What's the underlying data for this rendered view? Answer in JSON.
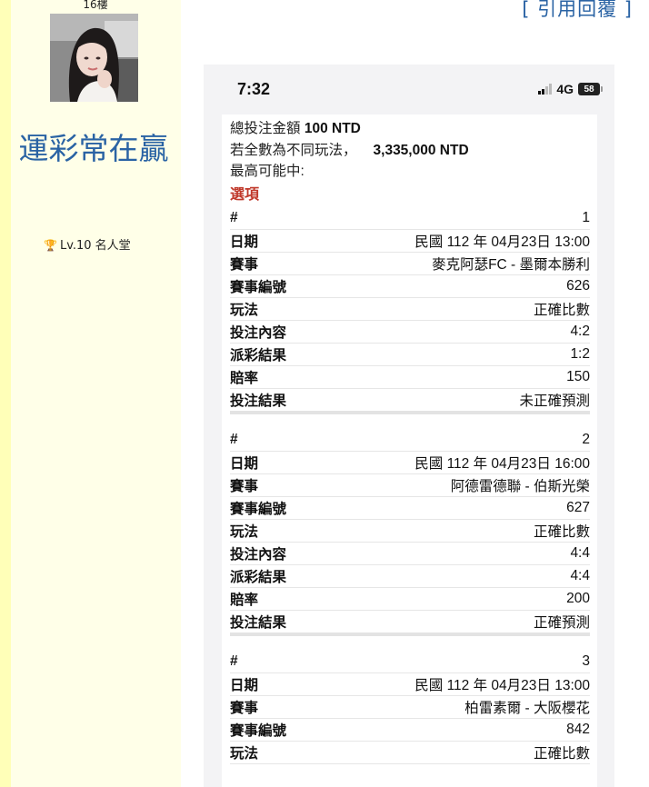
{
  "post": {
    "floor": "16樓",
    "quote_reply": "[ 引用回覆 ]"
  },
  "user": {
    "name": "運彩常在贏",
    "level": "Lv.10 名人堂",
    "level_icon": "trophy-icon"
  },
  "phone": {
    "time": "7:32",
    "network": "4G",
    "battery": "58"
  },
  "summary": {
    "total_label": "總投注金額",
    "total_value": "100 NTD",
    "alt_label": "若全數為不同玩法，",
    "alt_value": "3,335,000 NTD",
    "max_label": "最高可能中:"
  },
  "options_title": "選項",
  "labels": {
    "no": "#",
    "date": "日期",
    "match": "賽事",
    "match_id": "賽事編號",
    "play": "玩法",
    "content": "投注內容",
    "payout": "派彩結果",
    "odds": "賠率",
    "result": "投注結果"
  },
  "bets": [
    {
      "no": "1",
      "date": "民國 112 年 04月23日 13:00",
      "match": "麥克阿瑟FC - 墨爾本勝利",
      "match_id": "626",
      "play": "正確比數",
      "content": "4:2",
      "payout": "1:2",
      "odds": "150",
      "result": "未正確預測"
    },
    {
      "no": "2",
      "date": "民國 112 年 04月23日 16:00",
      "match": "阿德雷德聯 - 伯斯光榮",
      "match_id": "627",
      "play": "正確比數",
      "content": "4:4",
      "payout": "4:4",
      "odds": "200",
      "result": "正確預測"
    },
    {
      "no": "3",
      "date": "民國 112 年 04月23日 13:00",
      "match": "柏雷素爾 - 大阪櫻花",
      "match_id": "842",
      "play": "正確比數"
    }
  ]
}
